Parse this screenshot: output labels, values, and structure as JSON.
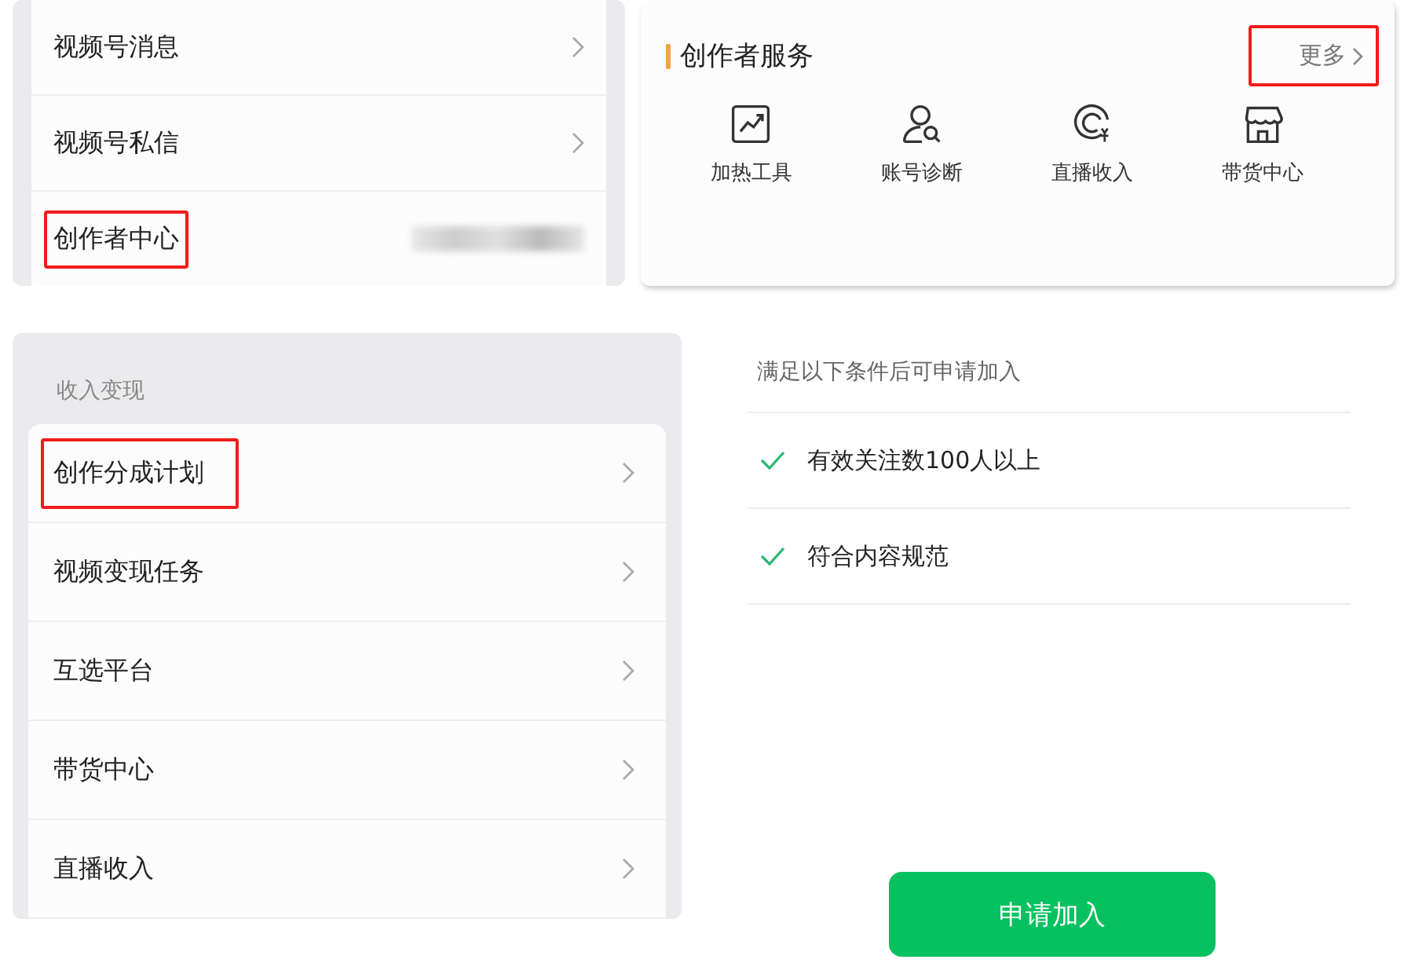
{
  "messages_list": {
    "items": [
      {
        "label": "视频号消息",
        "highlighted": false,
        "kind": "link"
      },
      {
        "label": "视频号私信",
        "highlighted": false,
        "kind": "link"
      },
      {
        "label": "创作者中心",
        "highlighted": true,
        "kind": "blurred"
      }
    ]
  },
  "creator_services": {
    "title": "创作者服务",
    "more": {
      "label": "更多",
      "highlighted": true
    },
    "items": [
      {
        "label": "加热工具",
        "kind": "chart"
      },
      {
        "label": "账号诊断",
        "kind": "user-search"
      },
      {
        "label": "直播收入",
        "kind": "coin"
      },
      {
        "label": "带货中心",
        "kind": "store"
      }
    ]
  },
  "income": {
    "section_title": "收入变现",
    "items": [
      {
        "label": "创作分成计划",
        "highlighted": true
      },
      {
        "label": "视频变现任务",
        "highlighted": false
      },
      {
        "label": "互选平台",
        "highlighted": false
      },
      {
        "label": "带货中心",
        "highlighted": false
      },
      {
        "label": "直播收入",
        "highlighted": false
      }
    ]
  },
  "conditions": {
    "heading": "满足以下条件后可申请加入",
    "items": [
      {
        "label": "有效关注数100人以上",
        "checked": true
      },
      {
        "label": "符合内容规范",
        "checked": true
      }
    ],
    "button": "申请加入"
  }
}
